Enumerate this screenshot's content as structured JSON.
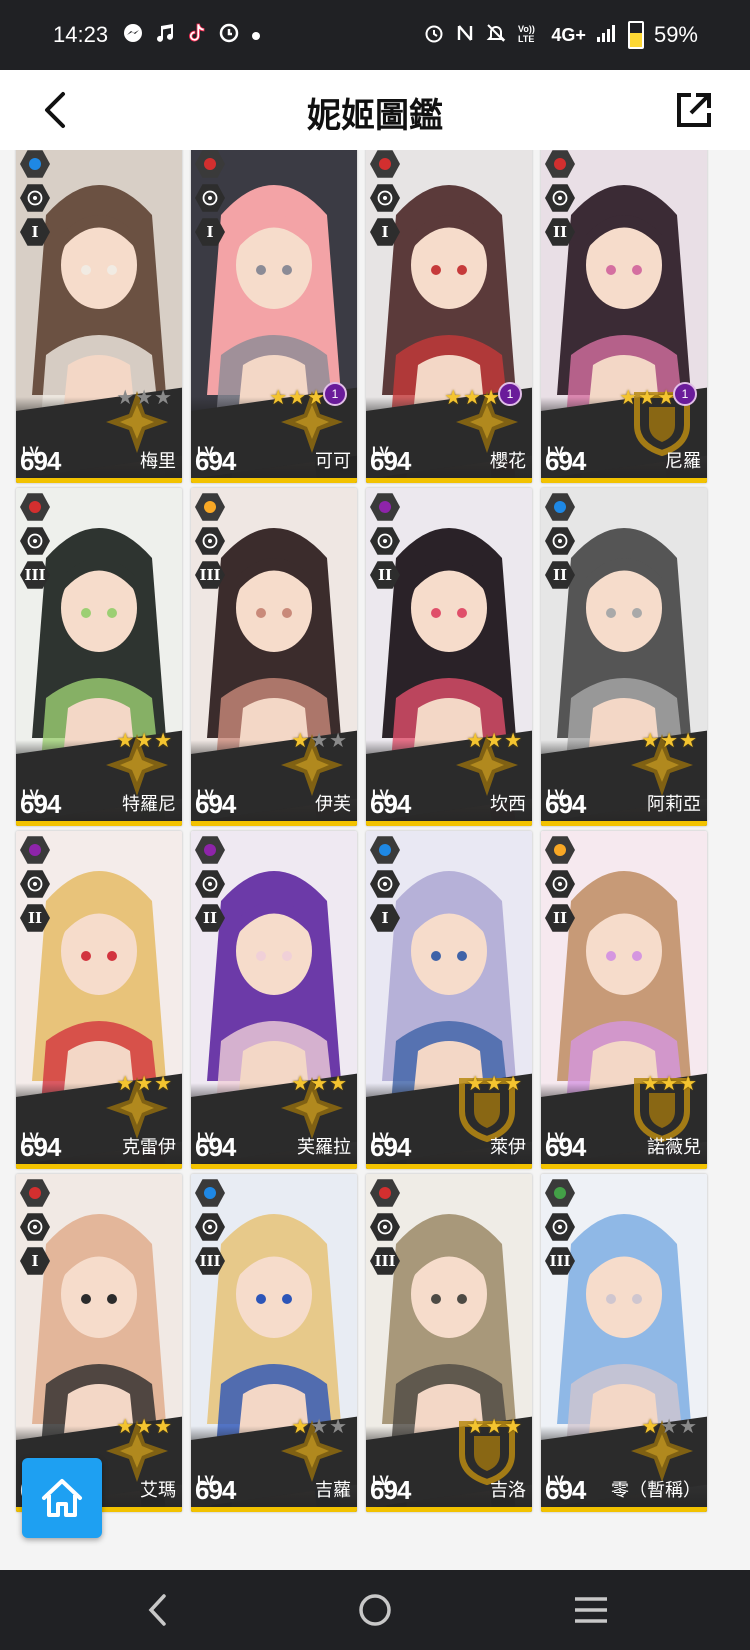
{
  "status_bar": {
    "time": "14:23",
    "left_icons": [
      "messenger-icon",
      "music-icon",
      "tiktok-icon",
      "cast-icon",
      "dot-icon"
    ],
    "right_icons": [
      "alarm-icon",
      "nfc-icon",
      "mute-icon",
      "volte-icon"
    ],
    "network": "4G+",
    "battery_percent": "59%",
    "battery_level": 0.59
  },
  "header": {
    "title": "妮姬圖鑑",
    "back_icon": "chevron-left-icon",
    "share_icon": "open-external-icon"
  },
  "cards": [
    {
      "name": "梅里",
      "lv_label": "LV.",
      "level": "694",
      "element": "water",
      "element_color": "#1e88e5",
      "burst": "I",
      "stars_on": 0,
      "stars_total": 3,
      "bond": "",
      "emblem": "cross"
    },
    {
      "name": "可可",
      "lv_label": "LV.",
      "level": "694",
      "element": "fire",
      "element_color": "#d32f2f",
      "burst": "I",
      "stars_on": 3,
      "stars_total": 3,
      "bond": "1",
      "emblem": "cross"
    },
    {
      "name": "櫻花",
      "lv_label": "LV.",
      "level": "694",
      "element": "fire",
      "element_color": "#d32f2f",
      "burst": "I",
      "stars_on": 3,
      "stars_total": 3,
      "bond": "1",
      "emblem": "cross"
    },
    {
      "name": "尼羅",
      "lv_label": "LV.",
      "level": "694",
      "element": "fire",
      "element_color": "#d32f2f",
      "burst": "II",
      "stars_on": 3,
      "stars_total": 3,
      "bond": "1",
      "emblem": "shield"
    },
    {
      "name": "特羅尼",
      "lv_label": "LV.",
      "level": "694",
      "element": "fire",
      "element_color": "#d32f2f",
      "burst": "III",
      "stars_on": 3,
      "stars_total": 3,
      "bond": "",
      "emblem": "cross"
    },
    {
      "name": "伊芙",
      "lv_label": "LV.",
      "level": "694",
      "element": "iron",
      "element_color": "#f9a825",
      "burst": "III",
      "stars_on": 1,
      "stars_total": 3,
      "bond": "",
      "emblem": "cross"
    },
    {
      "name": "坎西",
      "lv_label": "LV.",
      "level": "694",
      "element": "electric",
      "element_color": "#8e24aa",
      "burst": "II",
      "stars_on": 3,
      "stars_total": 3,
      "bond": "",
      "emblem": "cross"
    },
    {
      "name": "阿莉亞",
      "lv_label": "LV.",
      "level": "694",
      "element": "water",
      "element_color": "#1e88e5",
      "burst": "II",
      "stars_on": 3,
      "stars_total": 3,
      "bond": "",
      "emblem": "cross"
    },
    {
      "name": "克雷伊",
      "lv_label": "LV.",
      "level": "694",
      "element": "electric",
      "element_color": "#8e24aa",
      "burst": "II",
      "stars_on": 3,
      "stars_total": 3,
      "bond": "",
      "emblem": "cross"
    },
    {
      "name": "芙羅拉",
      "lv_label": "LV.",
      "level": "694",
      "element": "electric",
      "element_color": "#8e24aa",
      "burst": "II",
      "stars_on": 3,
      "stars_total": 3,
      "bond": "",
      "emblem": "cross"
    },
    {
      "name": "萊伊",
      "lv_label": "LV.",
      "level": "694",
      "element": "water",
      "element_color": "#1e88e5",
      "burst": "I",
      "stars_on": 3,
      "stars_total": 3,
      "bond": "",
      "emblem": "shield"
    },
    {
      "name": "諾薇兒",
      "lv_label": "LV.",
      "level": "694",
      "element": "iron",
      "element_color": "#f9a825",
      "burst": "II",
      "stars_on": 3,
      "stars_total": 3,
      "bond": "",
      "emblem": "shield"
    },
    {
      "name": "艾瑪",
      "lv_label": "LV.",
      "level": "694",
      "element": "fire",
      "element_color": "#d32f2f",
      "burst": "I",
      "stars_on": 3,
      "stars_total": 3,
      "bond": "",
      "emblem": "cross"
    },
    {
      "name": "吉蘿",
      "lv_label": "LV.",
      "level": "694",
      "element": "water",
      "element_color": "#1e88e5",
      "burst": "III",
      "stars_on": 1,
      "stars_total": 3,
      "bond": "",
      "emblem": "cross"
    },
    {
      "name": "吉洛",
      "lv_label": "LV.",
      "level": "694",
      "element": "fire",
      "element_color": "#d32f2f",
      "burst": "III",
      "stars_on": 3,
      "stars_total": 3,
      "bond": "",
      "emblem": "shield"
    },
    {
      "name": "零（暫稱）",
      "lv_label": "LV.",
      "level": "694",
      "element": "wind",
      "element_color": "#43a047",
      "burst": "III",
      "stars_on": 1,
      "stars_total": 3,
      "bond": "",
      "emblem": "cross"
    }
  ],
  "home_button": {
    "icon": "home-icon"
  },
  "nav_bar": {
    "back": "nav-back-icon",
    "home": "nav-home-icon",
    "recents": "nav-recents-icon"
  }
}
